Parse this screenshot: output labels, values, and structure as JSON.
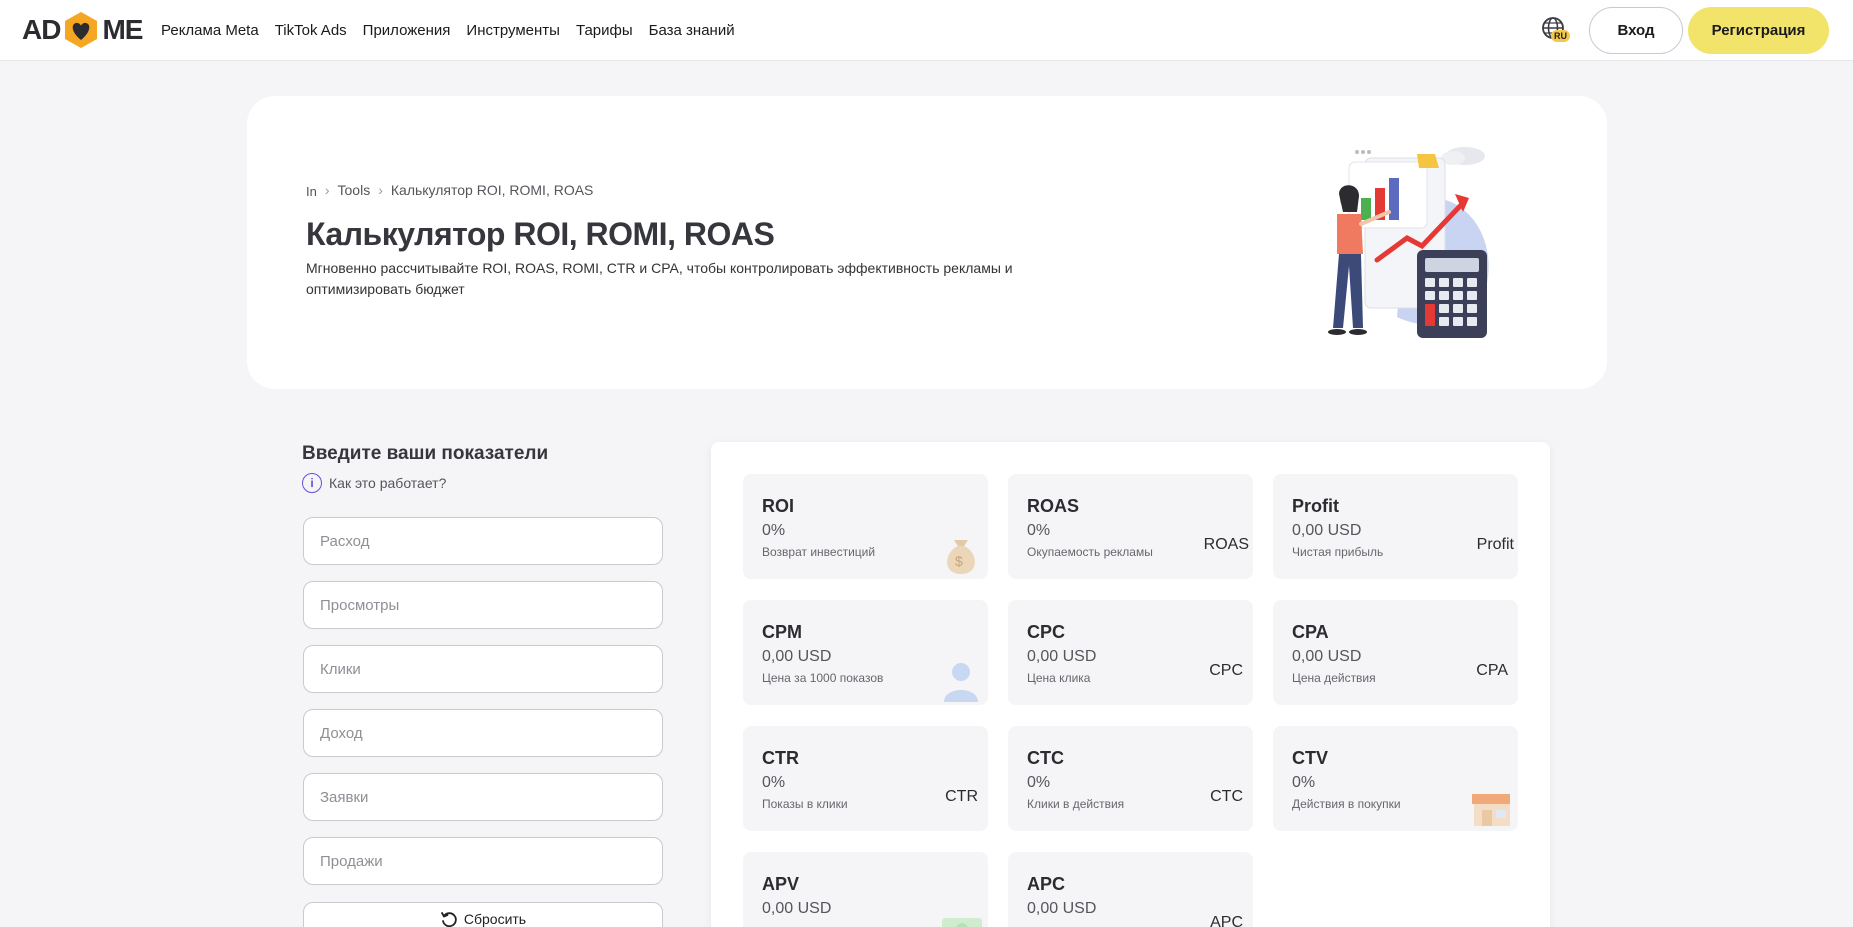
{
  "header": {
    "logo_left": "AD",
    "logo_right": "ME",
    "nav": [
      "Реклама Meta",
      "TikTok Ads",
      "Приложения",
      "Инструменты",
      "Тарифы",
      "База знаний"
    ],
    "lang_badge": "RU",
    "login_label": "Вход",
    "register_label": "Регистрация"
  },
  "hero": {
    "breadcrumb": {
      "home": "In",
      "tools": "Tools",
      "current": "Калькулятор ROI, ROMI, ROAS"
    },
    "title": "Калькулятор ROI, ROMI, ROAS",
    "description": "Мгновенно рассчитывайте ROI, ROAS, ROMI, CTR и CPA, чтобы контролировать эффективность рекламы и оптимизировать бюджет"
  },
  "form": {
    "title": "Введите ваши показатели",
    "how_it_works": "Как это работает?",
    "fields": [
      {
        "placeholder": "Расход"
      },
      {
        "placeholder": "Просмотры"
      },
      {
        "placeholder": "Клики"
      },
      {
        "placeholder": "Доход"
      },
      {
        "placeholder": "Заявки"
      },
      {
        "placeholder": "Продажи"
      }
    ],
    "reset_label": "Сбросить"
  },
  "results": [
    {
      "name": "ROI",
      "value": "0%",
      "desc": "Возврат инвестиций",
      "tag": "",
      "icon": "money-bag-icon"
    },
    {
      "name": "ROAS",
      "value": "0%",
      "desc": "Окупаемость рекламы",
      "tag": "ROAS",
      "icon": ""
    },
    {
      "name": "Profit",
      "value": "0,00 USD",
      "desc": "Чистая прибыль",
      "tag": "Profit",
      "icon": ""
    },
    {
      "name": "CPM",
      "value": "0,00 USD",
      "desc": "Цена за 1000 показов",
      "tag": "",
      "icon": "user-icon"
    },
    {
      "name": "CPC",
      "value": "0,00 USD",
      "desc": "Цена клика",
      "tag": "CPC",
      "icon": ""
    },
    {
      "name": "CPA",
      "value": "0,00 USD",
      "desc": "Цена действия",
      "tag": "CPA",
      "icon": ""
    },
    {
      "name": "CTR",
      "value": "0%",
      "desc": "Показы в клики",
      "tag": "CTR",
      "icon": ""
    },
    {
      "name": "CTC",
      "value": "0%",
      "desc": "Клики в действия",
      "tag": "CTC",
      "icon": ""
    },
    {
      "name": "CTV",
      "value": "0%",
      "desc": "Действия в покупки",
      "tag": "",
      "icon": "shop-icon"
    },
    {
      "name": "APV",
      "value": "0,00 USD",
      "desc": "",
      "tag": "",
      "icon": "banknote-icon"
    },
    {
      "name": "APC",
      "value": "0,00 USD",
      "desc": "",
      "tag": "APC",
      "icon": ""
    }
  ],
  "colors": {
    "accent_yellow": "#f2e46b",
    "accent_purple": "#6a4fd6",
    "logo_orange": "#f5a623"
  }
}
